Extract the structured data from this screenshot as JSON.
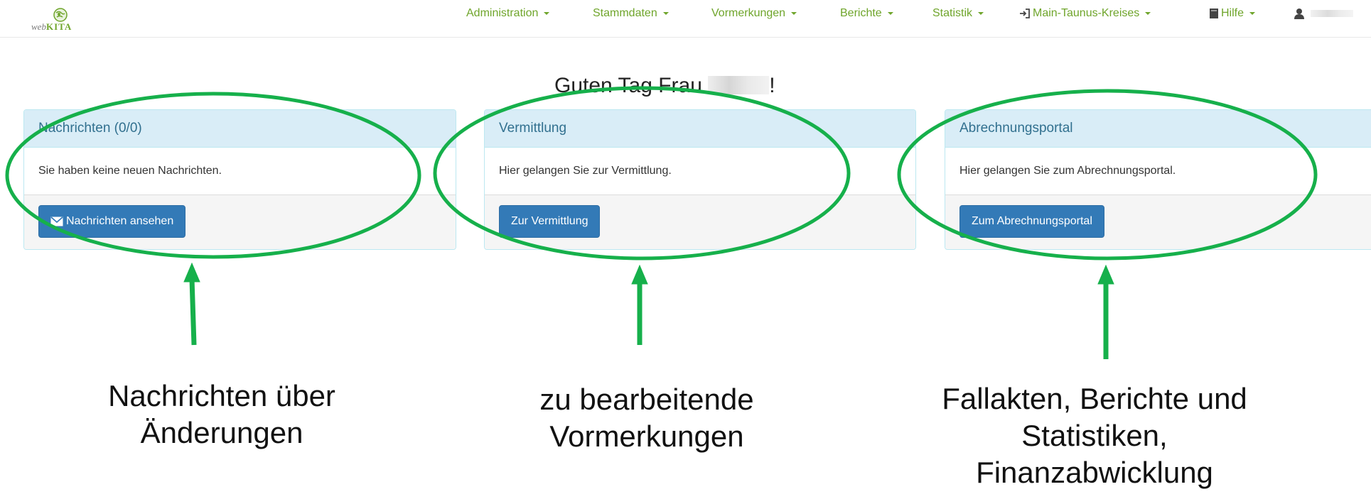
{
  "header": {
    "logo": {
      "part1": "web",
      "part2": "KITA"
    },
    "menu": [
      {
        "label": "Administration"
      },
      {
        "label": "Stammdaten"
      },
      {
        "label": "Vormerkungen"
      },
      {
        "label": "Berichte"
      },
      {
        "label": "Statistik"
      },
      {
        "label": "Main-Taunus-Kreises"
      },
      {
        "label": "Hilfe"
      }
    ]
  },
  "greeting": {
    "prefix": "Guten Tag Frau",
    "suffix": "!"
  },
  "panels": [
    {
      "title": "Nachrichten (0/0)",
      "body": "Sie haben keine neuen Nachrichten.",
      "button": "Nachrichten ansehen"
    },
    {
      "title": "Vermittlung",
      "body": "Hier gelangen Sie zur Vermittlung.",
      "button": "Zur Vermittlung"
    },
    {
      "title": "Abrechnungsportal",
      "body": "Hier gelangen Sie zum Abrechnungsportal.",
      "button": "Zum Abrechnungsportal"
    }
  ],
  "annotations": [
    {
      "line1": "Nachrichten über",
      "line2": "Änderungen"
    },
    {
      "line1": "zu bearbeitende",
      "line2": "Vormerkungen"
    },
    {
      "line1": "Fallakten, Berichte und",
      "line2": "Statistiken,",
      "line3": "Finanzabwicklung"
    }
  ],
  "colors": {
    "brand_green": "#6fa52b",
    "annotation_green": "#16b04b",
    "panel_heading_bg": "#d9edf7",
    "panel_heading_text": "#31708f",
    "button_primary": "#337ab7"
  },
  "icons": {
    "login": "login-icon",
    "book": "book-icon",
    "user": "user-icon",
    "envelope": "envelope-icon"
  }
}
